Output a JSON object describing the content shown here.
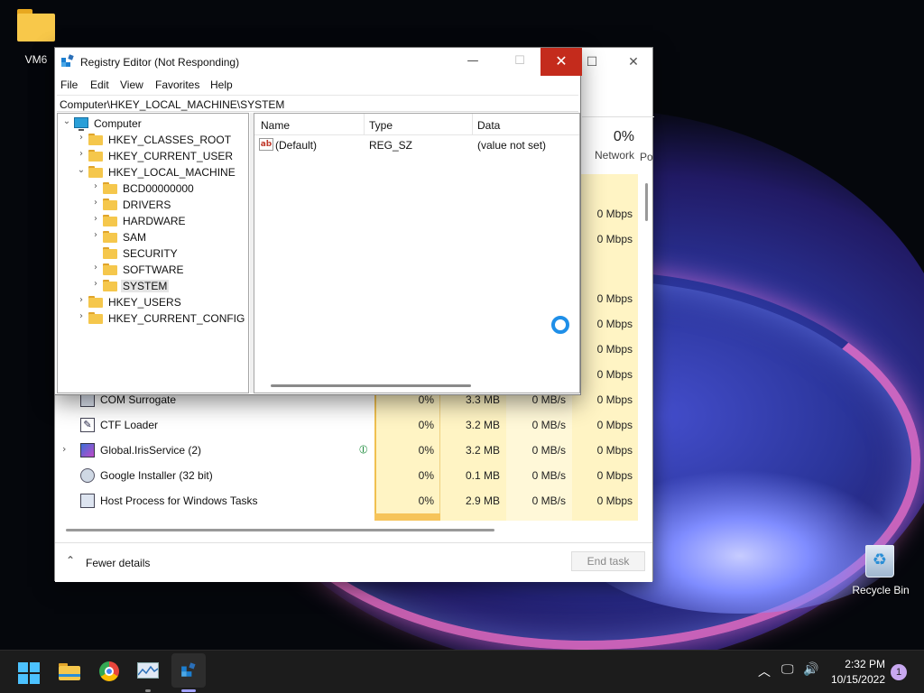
{
  "desktop": {
    "icons": [
      {
        "label": "VM6"
      },
      {
        "label": "Recycle Bin"
      }
    ]
  },
  "task_manager": {
    "columns": [
      {
        "pct": "0%",
        "label": "Network"
      },
      {
        "pct": "",
        "label": "Po"
      }
    ],
    "net_values_upper": [
      "0 Mbps",
      "0 Mbps",
      "0 Mbps",
      "0 Mbps",
      "0 Mbps",
      "0 Mbps"
    ],
    "rows": [
      {
        "name": "COM Surrogate",
        "cpu": "0%",
        "mem": "3.3 MB",
        "disk": "0 MB/s",
        "net": "0 Mbps"
      },
      {
        "name": "CTF Loader",
        "cpu": "0%",
        "mem": "3.2 MB",
        "disk": "0 MB/s",
        "net": "0 Mbps"
      },
      {
        "name": "Global.IrisService (2)",
        "cpu": "0%",
        "mem": "3.2 MB",
        "disk": "0 MB/s",
        "net": "0 Mbps"
      },
      {
        "name": "Google Installer (32 bit)",
        "cpu": "0%",
        "mem": "0.1 MB",
        "disk": "0 MB/s",
        "net": "0 Mbps"
      },
      {
        "name": "Host Process for Windows Tasks",
        "cpu": "0%",
        "mem": "2.9 MB",
        "disk": "0 MB/s",
        "net": "0 Mbps"
      }
    ],
    "footer": {
      "fewer_details": "Fewer details",
      "end_task": "End task"
    }
  },
  "regedit": {
    "title": "Registry Editor (Not Responding)",
    "menu": [
      "File",
      "Edit",
      "View",
      "Favorites",
      "Help"
    ],
    "address": "Computer\\HKEY_LOCAL_MACHINE\\SYSTEM",
    "tree": {
      "root": "Computer",
      "hives": [
        "HKEY_CLASSES_ROOT",
        "HKEY_CURRENT_USER",
        "HKEY_LOCAL_MACHINE",
        "HKEY_USERS",
        "HKEY_CURRENT_CONFIG"
      ],
      "hklm_children": [
        "BCD00000000",
        "DRIVERS",
        "HARDWARE",
        "SAM",
        "SECURITY",
        "SOFTWARE",
        "SYSTEM"
      ],
      "selected": "SYSTEM"
    },
    "list": {
      "headers": [
        "Name",
        "Type",
        "Data"
      ],
      "rows": [
        {
          "name": "(Default)",
          "type": "REG_SZ",
          "data": "(value not set)"
        }
      ]
    }
  },
  "taskbar": {
    "time": "2:32 PM",
    "date": "10/15/2022",
    "notification_count": "1",
    "accent": "#4cc2ff"
  }
}
